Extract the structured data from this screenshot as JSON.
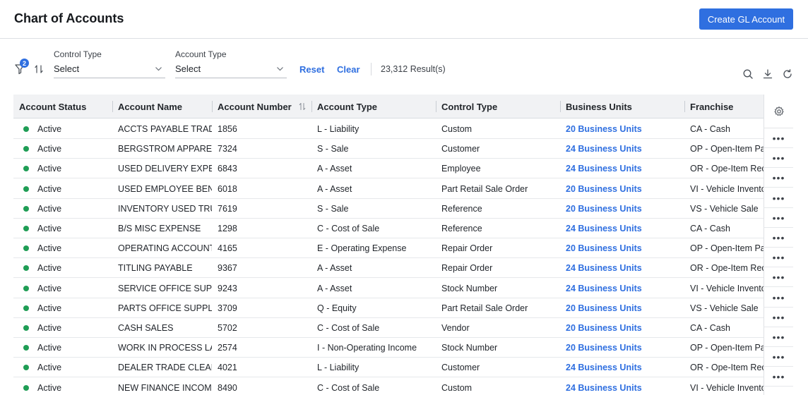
{
  "header": {
    "title": "Chart of Accounts",
    "create_button": "Create GL Account"
  },
  "toolbar": {
    "filter_badge": "2",
    "control_type": {
      "label": "Control Type",
      "value": "Select"
    },
    "account_type": {
      "label": "Account Type",
      "value": "Select"
    },
    "reset": "Reset",
    "clear": "Clear",
    "results": "23,312 Result(s)"
  },
  "colors": {
    "accent": "#2f6fe0",
    "active": "#1f9d55"
  },
  "table": {
    "columns": [
      "Account Status",
      "Account Name",
      "Account Number",
      "Account Type",
      "Control Type",
      "Business Units",
      "Franchise"
    ],
    "rows": [
      {
        "status": "Active",
        "name": "ACCTS PAYABLE TRADE",
        "number": "1856",
        "type": "L - Liability",
        "control": "Custom",
        "bu": "20 Business Units",
        "franchise": "CA - Cash"
      },
      {
        "status": "Active",
        "name": "BERGSTROM APPAREL",
        "number": "7324",
        "type": "S - Sale",
        "control": "Customer",
        "bu": "24 Business Units",
        "franchise": "OP - Open-Item Pay"
      },
      {
        "status": "Active",
        "name": "USED DELIVERY EXPENS",
        "number": "6843",
        "type": "A - Asset",
        "control": "Employee",
        "bu": "24 Business Units",
        "franchise": "OR - Ope-Item Recv"
      },
      {
        "status": "Active",
        "name": "USED EMPLOYEE BENEF",
        "number": "6018",
        "type": "A - Asset",
        "control": "Part Retail Sale Order",
        "bu": "20 Business Units",
        "franchise": "VI - Vehicle Invento"
      },
      {
        "status": "Active",
        "name": "INVENTORY USED TRUC",
        "number": "7619",
        "type": "S - Sale",
        "control": "Reference",
        "bu": "20 Business Units",
        "franchise": "VS - Vehicle Sale"
      },
      {
        "status": "Active",
        "name": "B/S MISC EXPENSE",
        "number": "1298",
        "type": "C - Cost of Sale",
        "control": "Reference",
        "bu": "24 Business Units",
        "franchise": "CA - Cash"
      },
      {
        "status": "Active",
        "name": "OPERATING ACCOUNT I",
        "number": "4165",
        "type": "E - Operating Expense",
        "control": "Repair Order",
        "bu": "20 Business Units",
        "franchise": "OP - Open-Item Pay"
      },
      {
        "status": "Active",
        "name": "TITLING PAYABLE",
        "number": "9367",
        "type": "A - Asset",
        "control": "Repair Order",
        "bu": "24 Business Units",
        "franchise": "OR - Ope-Item Recv"
      },
      {
        "status": "Active",
        "name": "SERVICE OFFICE SUPPL",
        "number": "9243",
        "type": "A - Asset",
        "control": "Stock Number",
        "bu": "24 Business Units",
        "franchise": "VI - Vehicle Invento"
      },
      {
        "status": "Active",
        "name": "PARTS OFFICE SUPPLIES",
        "number": "3709",
        "type": "Q - Equity",
        "control": "Part Retail Sale Order",
        "bu": "20 Business Units",
        "franchise": "VS - Vehicle Sale"
      },
      {
        "status": "Active",
        "name": "CASH SALES",
        "number": "5702",
        "type": "C - Cost of Sale",
        "control": "Vendor",
        "bu": "20 Business Units",
        "franchise": "CA - Cash"
      },
      {
        "status": "Active",
        "name": "WORK IN PROCESS LAB",
        "number": "2574",
        "type": "I - Non-Operating Income",
        "control": "Stock Number",
        "bu": "20 Business Units",
        "franchise": "OP - Open-Item Pay"
      },
      {
        "status": "Active",
        "name": "DEALER TRADE CLEARIN",
        "number": "4021",
        "type": "L - Liability",
        "control": "Customer",
        "bu": "24 Business Units",
        "franchise": "OR - Ope-Item Recv"
      },
      {
        "status": "Active",
        "name": "NEW FINANCE INCOME",
        "number": "8490",
        "type": "C - Cost of Sale",
        "control": "Custom",
        "bu": "24 Business Units",
        "franchise": "VI - Vehicle Invento"
      }
    ]
  }
}
